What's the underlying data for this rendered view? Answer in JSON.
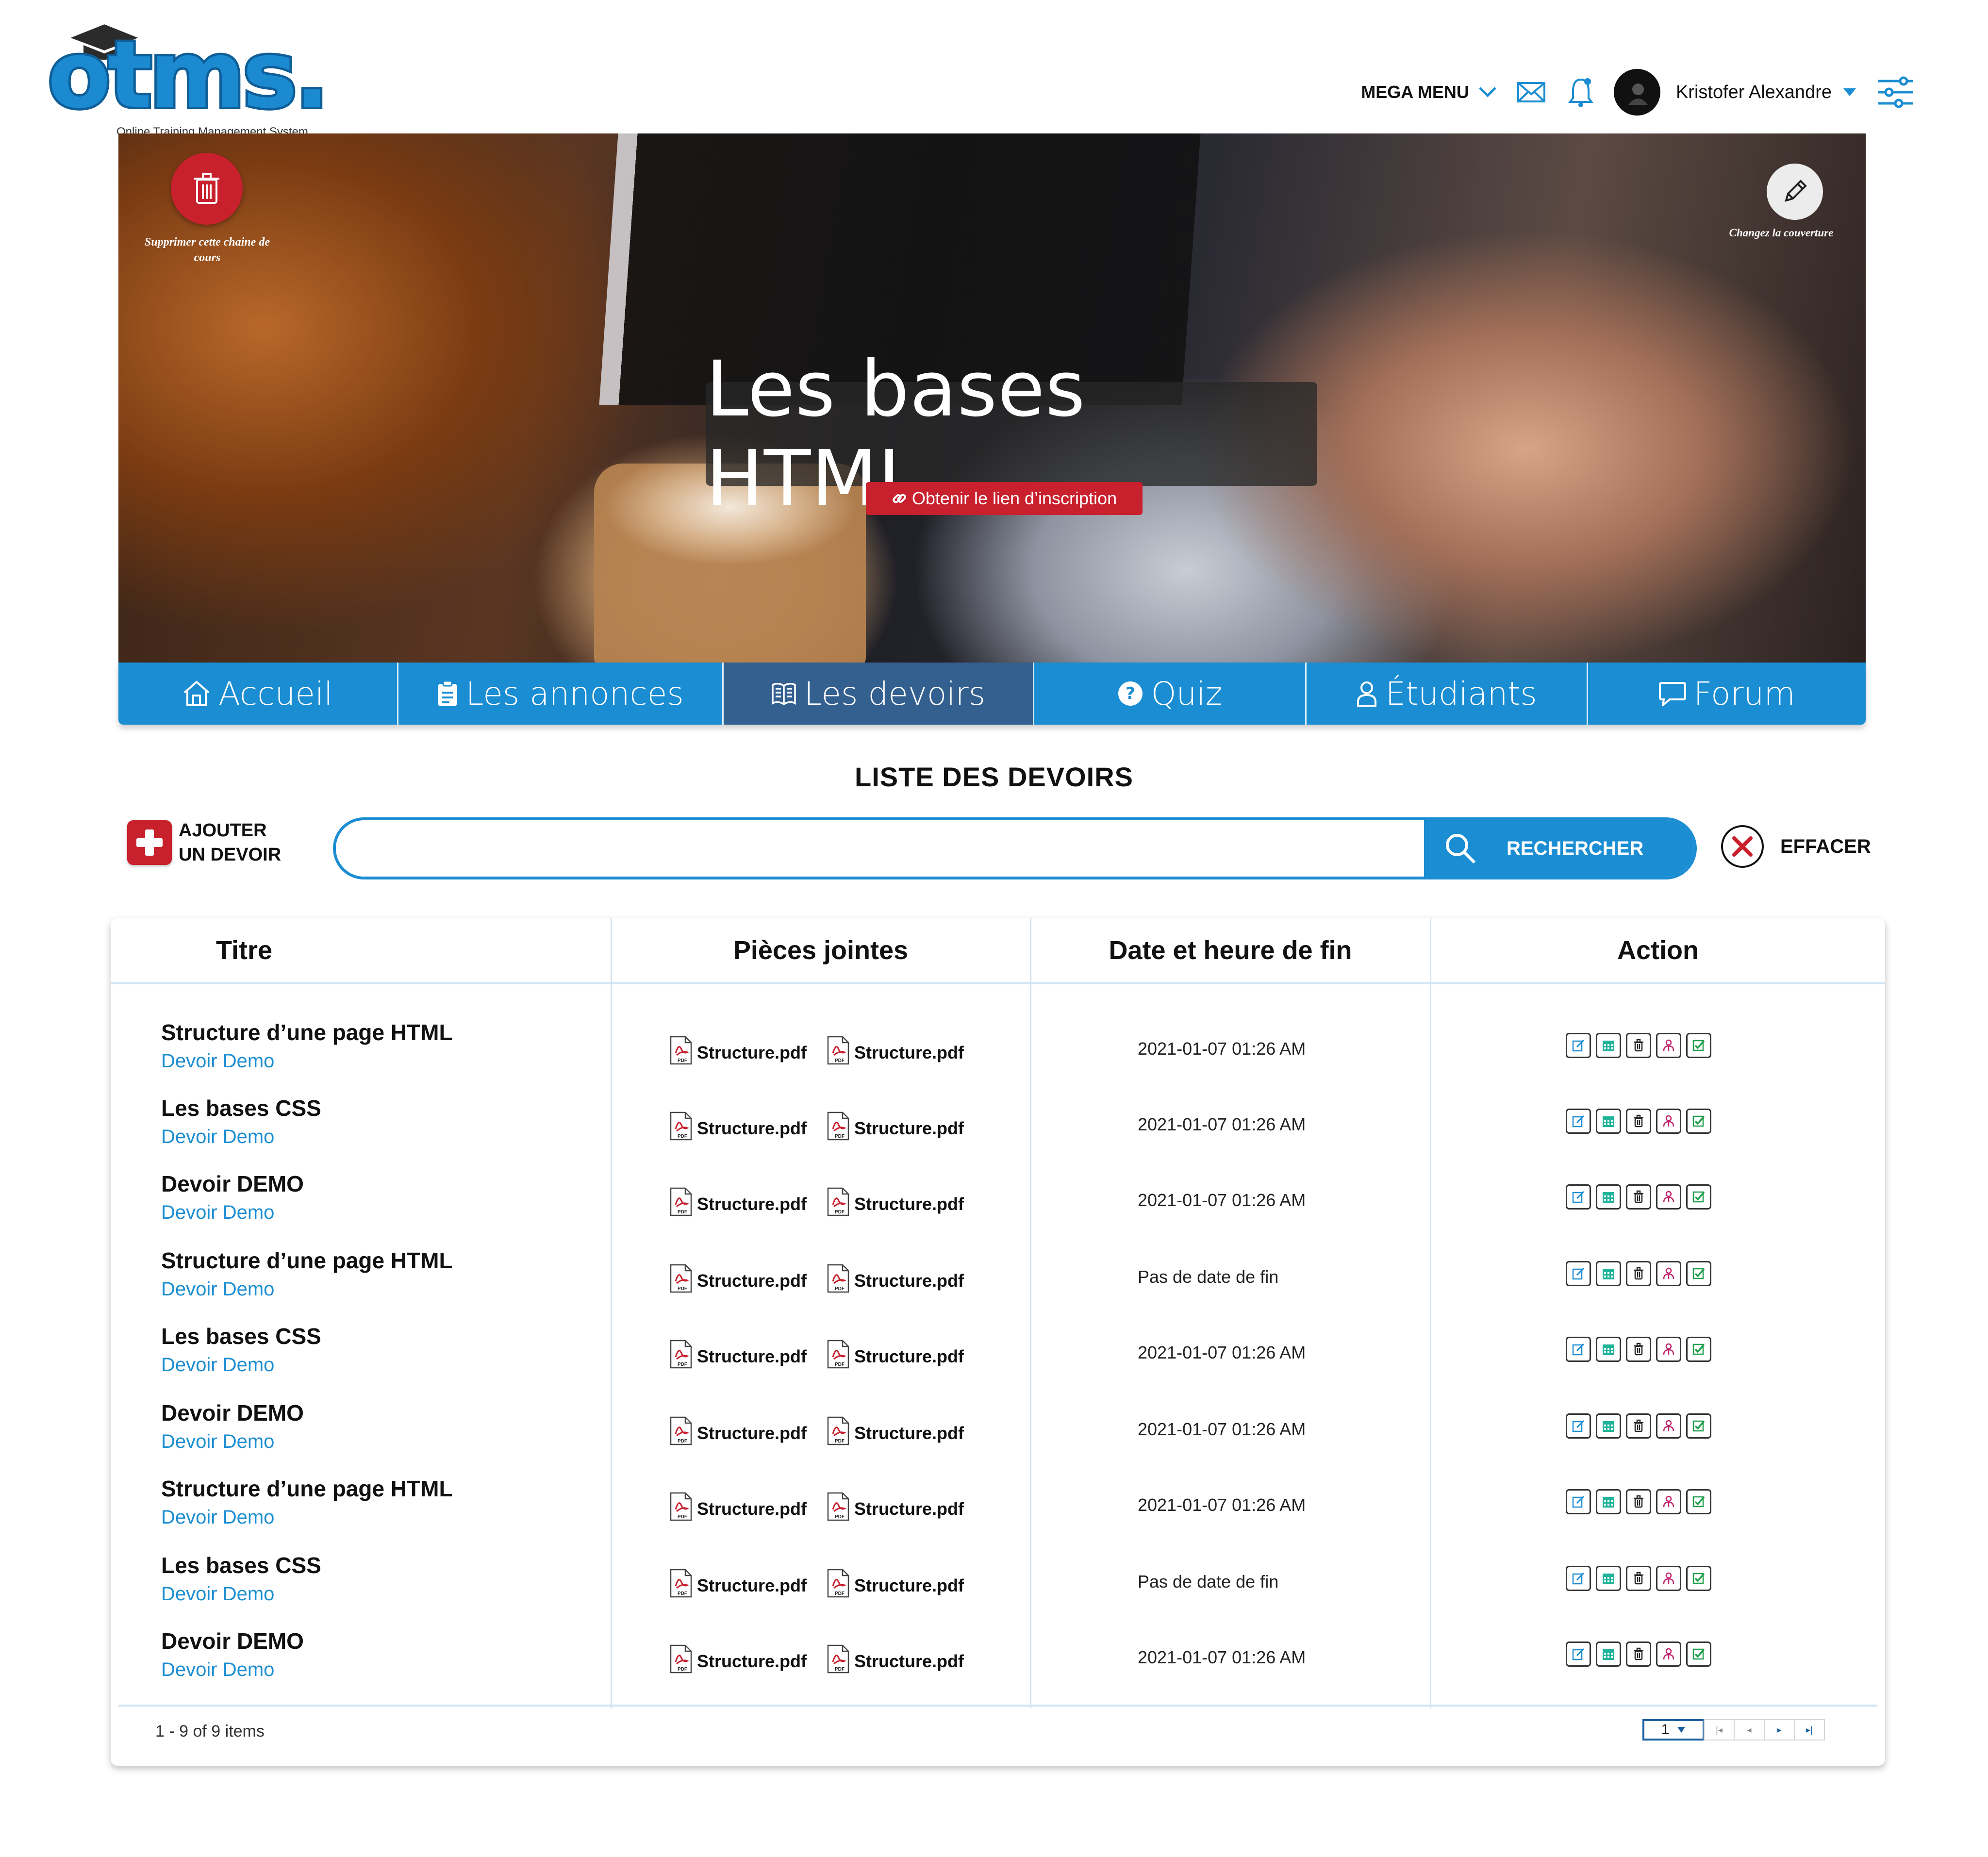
{
  "app": {
    "logo_text": "otms.",
    "logo_subtitle": "Online Training Management System"
  },
  "topnav": {
    "mega_menu": "MEGA MENU",
    "user_name": "Kristofer Alexandre"
  },
  "hero": {
    "course_title": "Les bases HTML",
    "delete_label": "Supprimer cette chaine de cours",
    "cover_label": "Changez la couverture",
    "enroll_link": "Obtenir le lien d’inscription"
  },
  "tabs": [
    {
      "label": "Accueil",
      "icon": "home-icon",
      "active": false
    },
    {
      "label": "Les annonces",
      "icon": "clipboard-icon",
      "active": false
    },
    {
      "label": "Les devoirs",
      "icon": "book-icon",
      "active": true
    },
    {
      "label": "Quiz",
      "icon": "question-icon",
      "active": false
    },
    {
      "label": "Étudiants",
      "icon": "user-icon",
      "active": false
    },
    {
      "label": "Forum",
      "icon": "chat-icon",
      "active": false
    }
  ],
  "list": {
    "title": "LISTE DES DEVOIRS",
    "add_line1": "AJOUTER",
    "add_line2": "UN DEVOIR",
    "search_value": "",
    "search_button": "RECHERCHER",
    "clear_button": "EFFACER"
  },
  "table": {
    "columns": [
      "Titre",
      "Pièces jointes",
      "Date et heure de fin",
      "Action"
    ],
    "rows": [
      {
        "title": "Structure d’une page HTML",
        "subtitle": "Devoir Demo",
        "attachments": [
          "Structure.pdf",
          "Structure.pdf"
        ],
        "end": "2021-01-07 01:26 AM"
      },
      {
        "title": "Les bases CSS",
        "subtitle": "Devoir Demo",
        "attachments": [
          "Structure.pdf",
          "Structure.pdf"
        ],
        "end": "2021-01-07 01:26 AM"
      },
      {
        "title": "Devoir DEMO",
        "subtitle": "Devoir Demo",
        "attachments": [
          "Structure.pdf",
          "Structure.pdf"
        ],
        "end": "2021-01-07 01:26 AM"
      },
      {
        "title": "Structure d’une page HTML",
        "subtitle": "Devoir Demo",
        "attachments": [
          "Structure.pdf",
          "Structure.pdf"
        ],
        "end": "Pas de date de fin"
      },
      {
        "title": "Les bases CSS",
        "subtitle": "Devoir Demo",
        "attachments": [
          "Structure.pdf",
          "Structure.pdf"
        ],
        "end": "2021-01-07 01:26 AM"
      },
      {
        "title": "Devoir DEMO",
        "subtitle": "Devoir Demo",
        "attachments": [
          "Structure.pdf",
          "Structure.pdf"
        ],
        "end": "2021-01-07 01:26 AM"
      },
      {
        "title": "Structure d’une page HTML",
        "subtitle": "Devoir Demo",
        "attachments": [
          "Structure.pdf",
          "Structure.pdf"
        ],
        "end": "2021-01-07 01:26 AM"
      },
      {
        "title": "Les bases CSS",
        "subtitle": "Devoir Demo",
        "attachments": [
          "Structure.pdf",
          "Structure.pdf"
        ],
        "end": "Pas de date de fin"
      },
      {
        "title": "Devoir DEMO",
        "subtitle": "Devoir Demo",
        "attachments": [
          "Structure.pdf",
          "Structure.pdf"
        ],
        "end": "2021-01-07 01:26 AM"
      }
    ],
    "action_icons": [
      {
        "name": "edit-icon",
        "color": "#1b8dd2"
      },
      {
        "name": "calendar-icon",
        "color": "#1fb39a"
      },
      {
        "name": "trash-icon",
        "color": "#222222"
      },
      {
        "name": "users-icon",
        "color": "#c0246e"
      },
      {
        "name": "check-icon",
        "color": "#1e9e4a"
      }
    ],
    "items_count": "1 - 9 of 9 items",
    "page": "1"
  },
  "colors": {
    "primary": "#1b8dd2",
    "active_tab": "#34608f",
    "danger": "#c8202d"
  }
}
